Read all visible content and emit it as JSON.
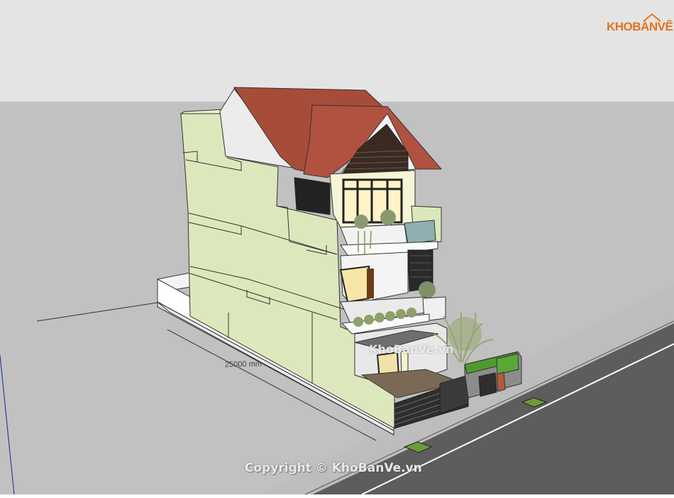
{
  "logo": {
    "text": "KHOBANVE",
    "alt_text": "KHOBÀNVẼ"
  },
  "dimension_label": "25000 mm",
  "watermark": "KhoBanVe.vn",
  "copyright": "Copyright © KhoBanVe.vn",
  "colors": {
    "sky": "#e3e3e3",
    "ground": "#c0c0c0",
    "road": "#5f5f5f",
    "wall": "#dce8bb",
    "roof": "#a84c3a",
    "logo": "#e4731b"
  }
}
